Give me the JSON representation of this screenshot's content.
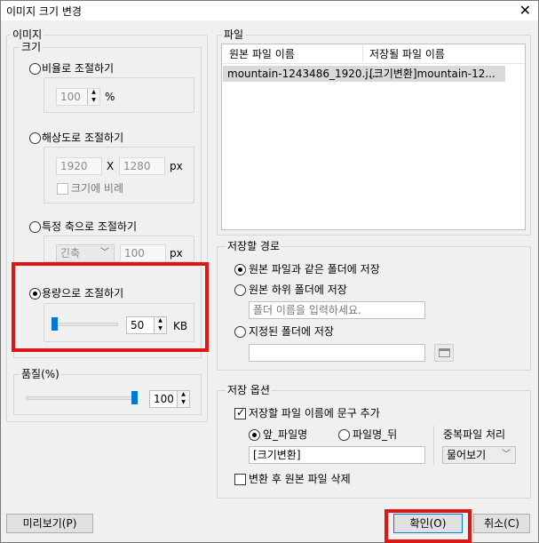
{
  "window": {
    "title": "이미지 크기 변경",
    "close_glyph": "✕"
  },
  "image_group": {
    "label": "이미지",
    "size_group": {
      "label": "크기",
      "ratio": {
        "label": "비율로 조절하기",
        "value": "100",
        "unit": "%"
      },
      "resolution": {
        "label": "해상도로 조절하기",
        "width": "1920",
        "times": "X",
        "height": "1280",
        "unit": "px",
        "keep_ratio_label": "크기에 비례"
      },
      "axis": {
        "label": "특정 축으로 조절하기",
        "axis_value": "긴축",
        "value": "100",
        "unit": "px"
      },
      "capacity": {
        "label": "용량으로 조절하기",
        "value": "50",
        "unit": "KB",
        "slider_level": 0
      }
    },
    "quality_group": {
      "label": "품질(%)",
      "value": "100",
      "slider_level": 1
    }
  },
  "file_group": {
    "label": "파일",
    "columns": [
      "원본 파일 이름",
      "저장될 파일 이름"
    ],
    "rows": [
      {
        "original": "mountain-1243486_1920.j...",
        "target": "[크기변환]mountain-12..."
      }
    ]
  },
  "save_path_group": {
    "label": "저장할 경로",
    "same_folder": "원본 파일과 같은 폴더에 저장",
    "sub_folder": "원본 하위 폴더에 저장",
    "sub_folder_placeholder": "폴더 이름을 입력하세요.",
    "chosen_folder": "지정된 폴더에 저장"
  },
  "save_options_group": {
    "label": "저장 옵션",
    "add_text_label": "저장할 파일 이름에 문구 추가",
    "prefix_label": "앞_파일명",
    "suffix_label": "파일명_뒤",
    "text_value": "[크기변환]",
    "duplicate_label": "중복파일 처리",
    "duplicate_value": "물어보기",
    "delete_original_label": "변환 후 원본 파일 삭제"
  },
  "buttons": {
    "preview": "미리보기(P)",
    "ok": "확인(O)",
    "cancel": "취소(C)"
  },
  "colors": {
    "accent": "#0078d7",
    "highlight": "#e01515"
  }
}
